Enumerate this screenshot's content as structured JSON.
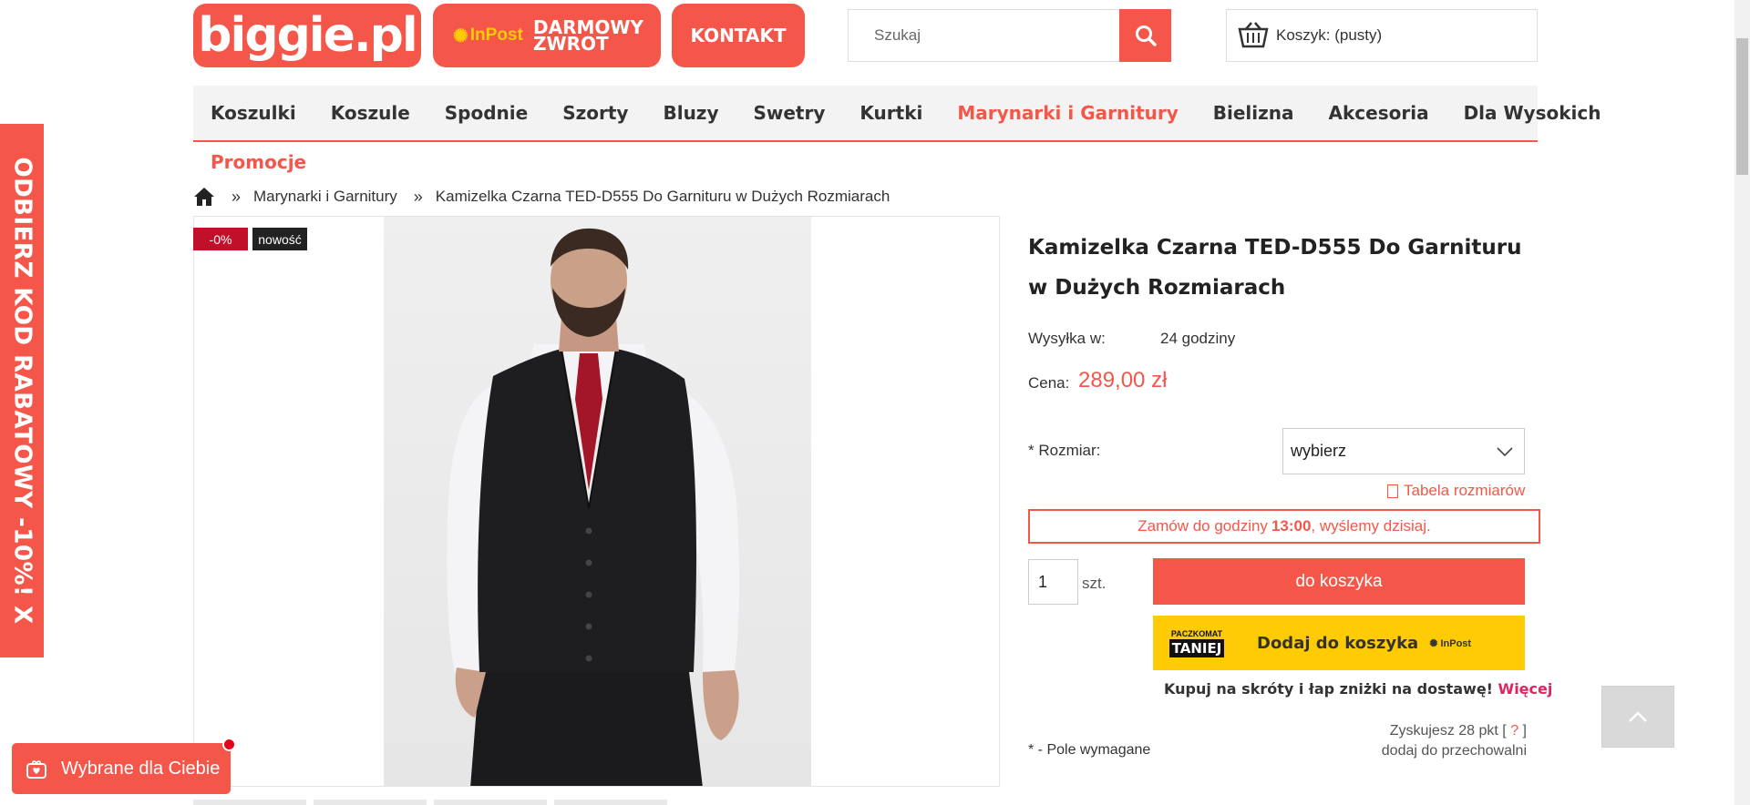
{
  "header": {
    "logo_text": "biggie.pl",
    "inpost_logo": "InPost",
    "inpost_text": "DARMOWY ZWROT",
    "contact_label": "KONTAKT",
    "search_placeholder": "Szukaj",
    "cart_text": "Koszyk: (pusty)"
  },
  "nav": {
    "items": [
      "Koszulki",
      "Koszule",
      "Spodnie",
      "Szorty",
      "Bluzy",
      "Swetry",
      "Kurtki",
      "Marynarki i Garnitury",
      "Bielizna",
      "Akcesoria",
      "Dla Wysokich"
    ],
    "active": "Marynarki i Garnitury",
    "promo": "Promocje"
  },
  "breadcrumb": {
    "sep": "»",
    "category": "Marynarki i Garnitury",
    "current": "Kamizelka Czarna TED-D555 Do Garnituru w Dużych Rozmiarach"
  },
  "badges": {
    "sale": "-0%",
    "new": "nowość"
  },
  "product": {
    "title": "Kamizelka Czarna TED-D555 Do Garnituru w Dużych Rozmiarach",
    "shipping_label": "Wysyłka w:",
    "shipping_value": "24 godziny",
    "price_label": "Cena:",
    "price_value": "289,00 zł",
    "size_label": "* Rozmiar:",
    "size_selected": "wybierz",
    "size_table": "Tabela rozmiarów",
    "deadline_pre": "Zamów do godziny",
    "deadline_time": "13:00",
    "deadline_post": ", wyślemy dzisiaj.",
    "quantity": "1",
    "quantity_unit": "szt.",
    "add_to_cart": "do koszyka",
    "pacz_top": "PACZKOMAT",
    "pacz_bottom": "TANIEJ",
    "pacz_button": "Dodaj do koszyka",
    "pacz_inpost": "InPost",
    "shortcut_text": "Kupuj na skróty i łap zniżki na dostawę!",
    "shortcut_more": "Więcej",
    "points_pre": "Zyskujesz 28 pkt [",
    "points_q": "?",
    "points_post": "]",
    "points_line2": "dodaj do przechowalni",
    "required_note": "* - Pole wymagane"
  },
  "side_promo": "ODBIERZ KOD RABATOWY -10%!  X",
  "wybrane_label": "Wybrane dla Ciebie",
  "colors": {
    "accent": "#f4574a",
    "yellow": "#ffcb05",
    "sale_badge": "#c0102a"
  },
  "icons": [
    "search-icon",
    "cart-icon",
    "home-icon",
    "chevron-down-icon",
    "size-table-icon",
    "chevron-up-icon",
    "gift-heart-icon"
  ]
}
